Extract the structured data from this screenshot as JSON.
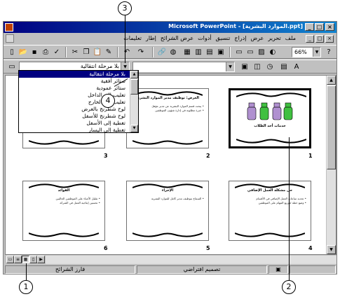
{
  "window": {
    "title": "Microsoft PowerPoint - [الموارد البشرية.ppt]",
    "caption_buttons": [
      "_",
      "□",
      "×"
    ]
  },
  "menu": {
    "items": [
      "ملف",
      "تحرير",
      "عرض",
      "إدراج",
      "تنسيق",
      "أدوات",
      "عرض الشرائح",
      "إطار",
      "تعليمات"
    ],
    "doc_buttons": [
      "_",
      "□",
      "×"
    ]
  },
  "toolbar": {
    "zoom_value": "66%",
    "icons": [
      "new-icon",
      "open-icon",
      "save-icon",
      "print-icon",
      "spell-icon",
      "cut-icon",
      "copy-icon",
      "paste-icon",
      "format-painter-icon",
      "undo-icon",
      "redo-icon",
      "hyperlink-icon",
      "web-icon",
      "table-icon",
      "chart-icon",
      "new-slide-icon",
      "layout-icon",
      "apply-design-icon",
      "black-white-icon",
      "help-icon"
    ]
  },
  "sorter_toolbar": {
    "transition_value": "بلا مرحلة انتقالية",
    "animation_value": ""
  },
  "transition_list": {
    "items": [
      "بلا مرحلة انتقالية",
      "ستائر أفقية",
      "ستائر عمودية",
      "تعليب إلى الداخل",
      "تعليب إلى الخارج",
      "لوح شطرنج بالعرض",
      "لوح شطرنج للأسفل",
      "تغطية إلى الأسفل",
      "تغطية إلى اليسار"
    ],
    "selected_index": 0
  },
  "slides": [
    {
      "number": "1",
      "title": "",
      "caption": "خدمات أحد الطلاب",
      "body": [],
      "selected": true
    },
    {
      "number": "2",
      "title": "الغرض: توظيف مدير الموارد البشرية",
      "body": [
        "• يبحث قسم الموارد البشرية عن مدير مؤهل",
        "• خبرة مطلوبة في إدارة شؤون الموظفين"
      ],
      "selected": false
    },
    {
      "number": "3",
      "title": "",
      "body": [],
      "selected": false
    },
    {
      "number": "4",
      "title": "حل مشكلة العمل الإضافي",
      "body": [
        "• تحديد ساعات العمل الإضافي في الأقسام",
        "• وضع خطة لتوزيع المهام على الموظفين"
      ],
      "selected": false
    },
    {
      "number": "5",
      "title": "الإجراء",
      "body": [
        "• السماح بتوظيف مدير كامل للموارد البشرية"
      ],
      "selected": false
    },
    {
      "number": "6",
      "title": "الفوائد",
      "body": [
        "• تقليل الأعباء على الموظفين الحاليين",
        "• تحسين إنتاجية العمل في الشركة"
      ],
      "selected": false
    }
  ],
  "status": {
    "view_name": "فارز الشرائح",
    "design_name": "تصميم افتراضي"
  },
  "callouts": [
    "1",
    "2",
    "3",
    "4"
  ]
}
